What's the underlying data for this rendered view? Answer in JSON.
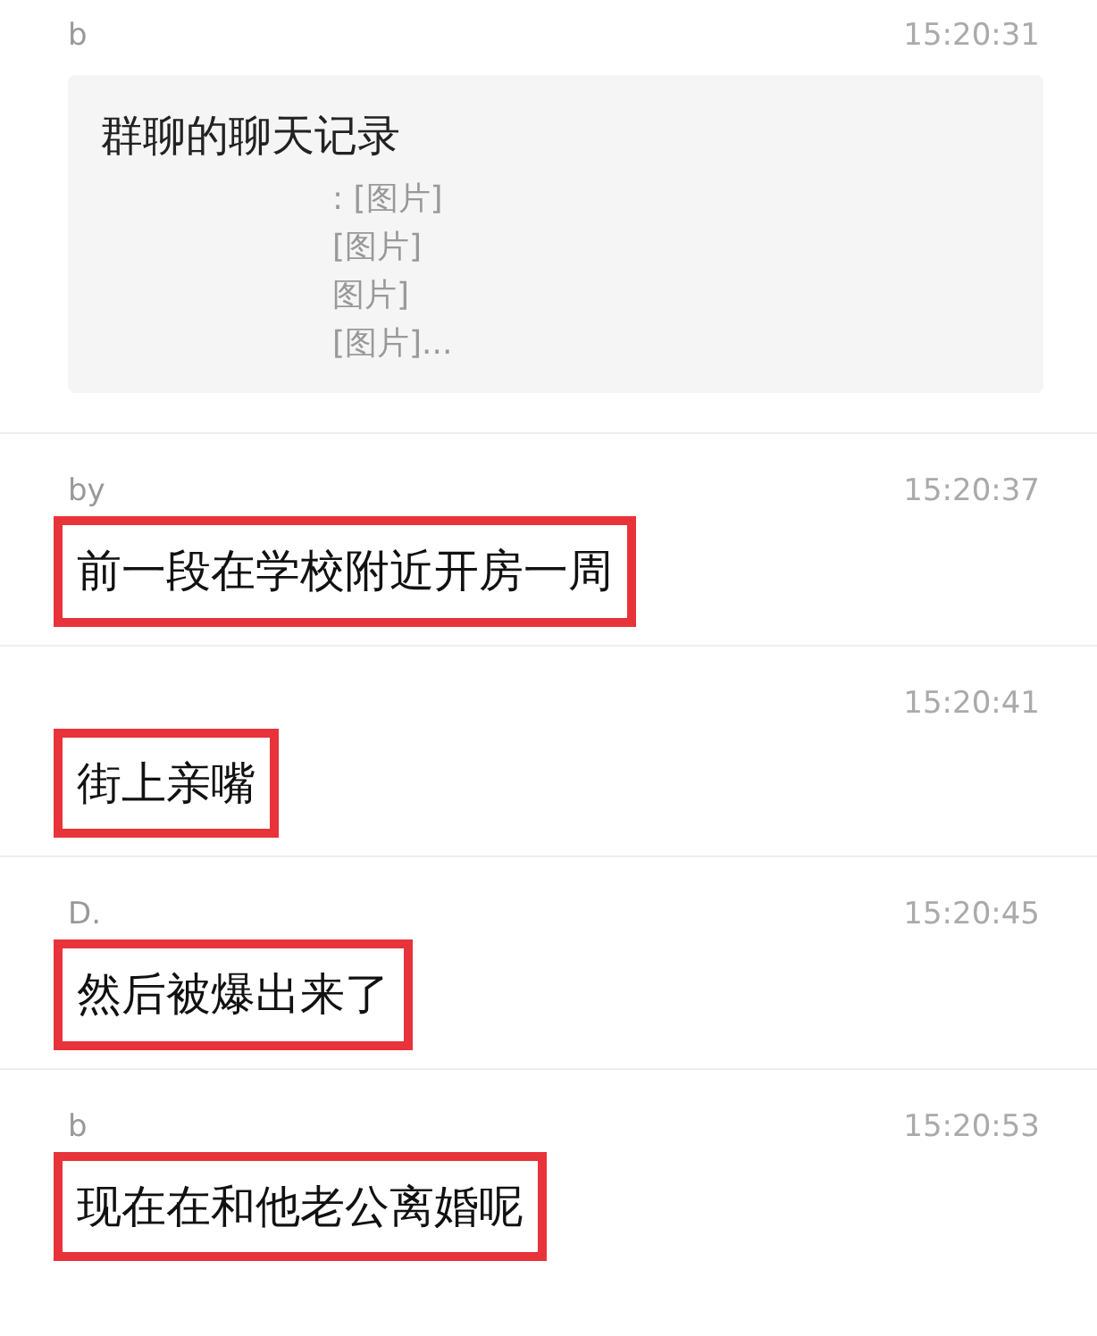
{
  "messages": [
    {
      "kind": "record",
      "sender": "b",
      "time": "15:20:31",
      "title": "群聊的聊天记录",
      "lines": [
        ": [图片]",
        "[图片]",
        "图片]",
        "[图片]..."
      ]
    },
    {
      "kind": "text",
      "sender": "by",
      "time": "15:20:37",
      "text": "前一段在学校附近开房一周",
      "highlighted": true
    },
    {
      "kind": "text",
      "time": "15:20:41",
      "text": "街上亲嘴",
      "highlighted": true
    },
    {
      "kind": "text",
      "sender": "D.",
      "time": "15:20:45",
      "text": "然后被爆出来了",
      "highlighted": true
    },
    {
      "kind": "text",
      "sender": "b",
      "time": "15:20:53",
      "text": "现在在和他老公离婚呢",
      "highlighted": true
    }
  ]
}
